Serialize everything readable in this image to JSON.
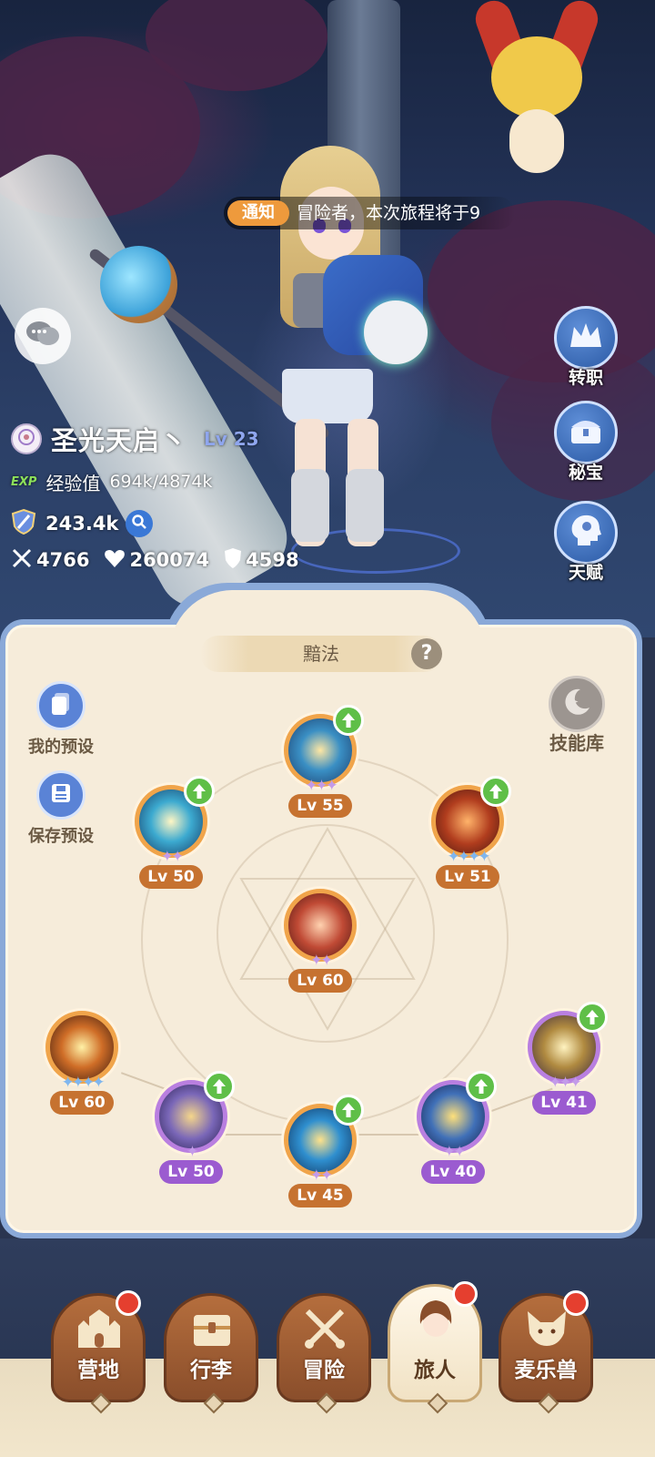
{
  "notice": {
    "tag": "通知",
    "text": "冒险者，本次旅程将于9"
  },
  "side_menu": [
    {
      "label": "转职",
      "icon": "crown-icon"
    },
    {
      "label": "秘宝",
      "icon": "treasure-chest-icon"
    },
    {
      "label": "天赋",
      "icon": "head-brain-icon"
    }
  ],
  "player": {
    "name": "圣光天启丶",
    "level": "Lv 23",
    "exp_tag": "EXP",
    "exp_label": "经验值",
    "exp_value": "694k/4874k",
    "power": "243.4k",
    "attack": "4766",
    "hp": "260074",
    "defense": "4598"
  },
  "panel": {
    "title": "黯法",
    "help": "?",
    "presets": [
      {
        "label": "我的预设"
      },
      {
        "label": "保存预设"
      }
    ],
    "library": {
      "label": "技能库"
    }
  },
  "skills": [
    {
      "level": "Lv 55",
      "stars": "✦✦✦",
      "upgrade": true,
      "tier": "gold"
    },
    {
      "level": "Lv 50",
      "stars": "✦✦",
      "upgrade": true,
      "tier": "gold"
    },
    {
      "level": "Lv 51",
      "stars": "✦✦✦✦",
      "upgrade": true,
      "tier": "gold"
    },
    {
      "level": "Lv 60",
      "stars": "✦✦",
      "upgrade": false,
      "tier": "gold"
    },
    {
      "level": "Lv 60",
      "stars": "✦✦✦✦",
      "upgrade": false,
      "tier": "gold"
    },
    {
      "level": "Lv 50",
      "stars": "✦",
      "upgrade": true,
      "tier": "purple"
    },
    {
      "level": "Lv 45",
      "stars": "✦✦",
      "upgrade": true,
      "tier": "gold"
    },
    {
      "level": "Lv 40",
      "stars": "✦✦",
      "upgrade": true,
      "tier": "purple"
    },
    {
      "level": "Lv 41",
      "stars": "✦✦✦",
      "upgrade": true,
      "tier": "purple"
    }
  ],
  "nav": [
    {
      "label": "营地",
      "badge": true,
      "active": false
    },
    {
      "label": "行李",
      "badge": false,
      "active": false
    },
    {
      "label": "冒险",
      "badge": false,
      "active": false
    },
    {
      "label": "旅人",
      "badge": true,
      "active": true
    },
    {
      "label": "麦乐兽",
      "badge": true,
      "active": false
    }
  ],
  "colors": {
    "accent_gold": "#c67230",
    "accent_purple": "#9b5bd0",
    "panel_bg": "#f6ecda",
    "panel_border": "#8aa9d8"
  }
}
